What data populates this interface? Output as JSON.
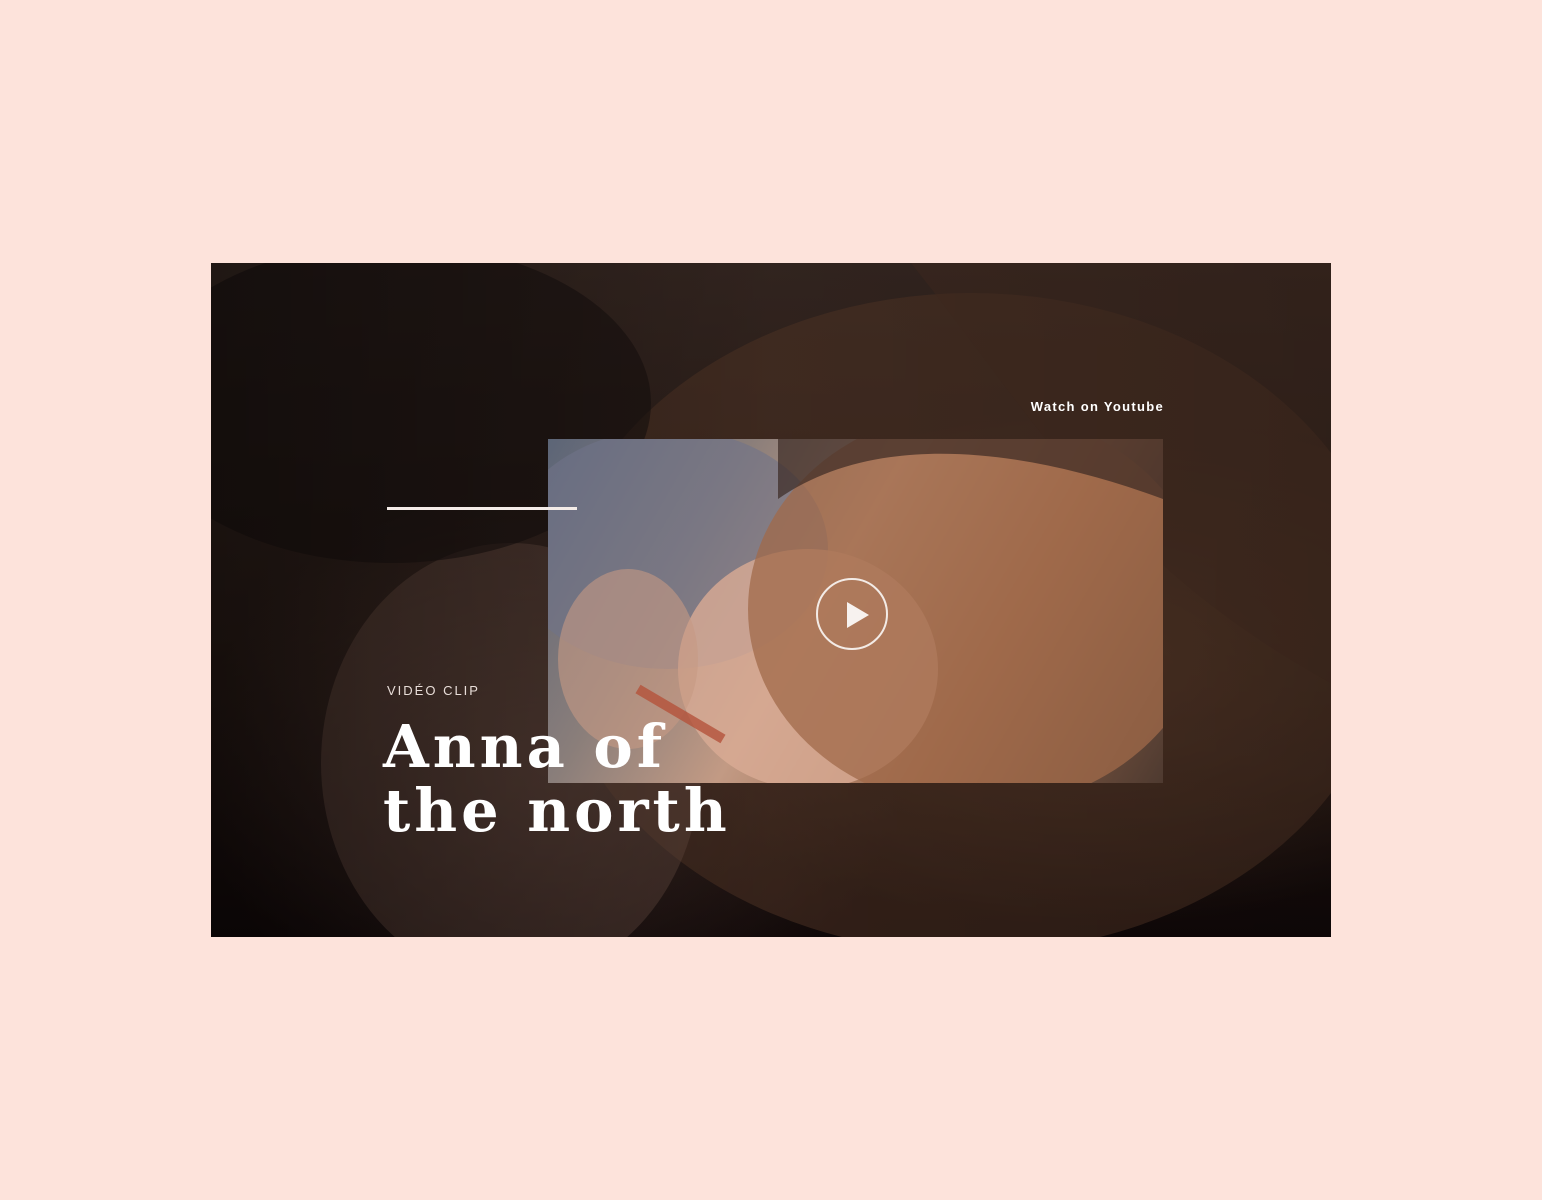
{
  "hero": {
    "watch_link": "Watch on Youtube",
    "kicker": "VIDÉO CLIP",
    "title": "Anna of the north",
    "play_icon": "play-circle-icon"
  },
  "colors": {
    "page_background": "#fde3db",
    "title_text": "#ffffff",
    "accent_rule": "#f4ece8"
  }
}
